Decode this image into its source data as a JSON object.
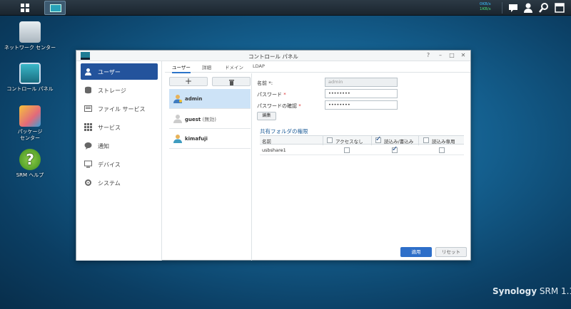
{
  "taskbar": {
    "speed_up": "0KB/s",
    "speed_down": "1KB/s"
  },
  "desktop": {
    "icons": [
      {
        "label": "ネットワーク センター"
      },
      {
        "label": "コントロール パネル"
      },
      {
        "label": "パッケージ\nセンター"
      },
      {
        "label": "SRM ヘルプ"
      }
    ]
  },
  "window": {
    "title": "コントロール パネル",
    "sidebar": [
      {
        "label": "ユーザー"
      },
      {
        "label": "ストレージ"
      },
      {
        "label": "ファイル サービス"
      },
      {
        "label": "サービス"
      },
      {
        "label": "通知"
      },
      {
        "label": "デバイス"
      },
      {
        "label": "システム"
      }
    ],
    "tabs": [
      {
        "label": "ユーザー"
      },
      {
        "label": "詳細"
      },
      {
        "label": "ドメイン"
      },
      {
        "label": "LDAP"
      }
    ],
    "users": [
      {
        "name": "admin",
        "extra": ""
      },
      {
        "name": "guest",
        "extra": " (無効)"
      },
      {
        "name": "kimafuji",
        "extra": ""
      }
    ],
    "form": {
      "name_label": "名前 *:",
      "name_value": "admin",
      "password_label": "パスワード",
      "password_value": "••••••••",
      "confirm_label": "パスワードの確認",
      "confirm_value": "••••••••",
      "edit_button": "編集",
      "shared_section": "共有フォルダの権限",
      "col_name": "名前",
      "col_noaccess": "アクセスなし",
      "col_rw": "読込み/書込み",
      "col_ro": "読込み専用",
      "rows": [
        {
          "name": "usbshare1",
          "noaccess": false,
          "rw": true,
          "ro": false
        }
      ]
    },
    "apply_button": "適用",
    "reset_button": "リセット"
  },
  "brand": {
    "name": "Synology",
    "product": "SRM 1.1"
  }
}
